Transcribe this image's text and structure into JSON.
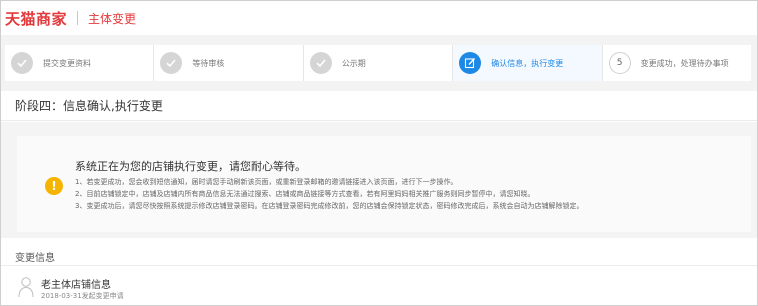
{
  "header": {
    "logo_text": "天猫商家",
    "title": "主体变更"
  },
  "steps": [
    {
      "label": "提交变更资料",
      "state": "done"
    },
    {
      "label": "等待审核",
      "state": "done"
    },
    {
      "label": "公示期",
      "state": "done"
    },
    {
      "label": "确认信息，执行变更",
      "state": "active"
    },
    {
      "label": "变更成功，处理待办事项",
      "state": "todo",
      "number": "5"
    }
  ],
  "stage": {
    "title": "阶段四：信息确认,执行变更"
  },
  "notice": {
    "icon": "warning-icon",
    "icon_glyph": "!",
    "title": "系统正在为您的店铺执行变更，请您耐心等待。",
    "lines": [
      "1、若变更成功，您会收到短信通知，届时请您手动刷新该页面，或重新登录邮箱的邀请链接进入该页面，进行下一步操作。",
      "2、目前店铺锁定中，店铺及店铺内所有商品信息无法通过搜索、店铺或商品链接等方式查看，若有阿里妈妈相关推广服务则同步暂停中，请您知晓。",
      "3、变更成功后，请您尽快按照系统提示修改店铺登录密码。在店铺登录密码完成修改前，您的店铺会保持锁定状态，密码修改完成后，系统会自动为店铺解除锁定。"
    ]
  },
  "change_info": {
    "section_title": "变更信息",
    "entry_title": "老主体店铺信息",
    "entry_date": "2018-03-31发起变更申请"
  },
  "colors": {
    "brand": "#e4393c",
    "active_step": "#1e88e5",
    "warning": "#f5b400"
  }
}
